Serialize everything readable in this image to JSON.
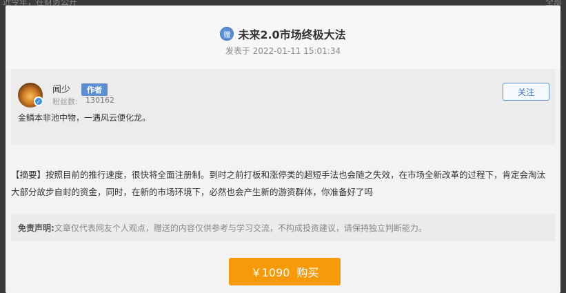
{
  "backdrop": {
    "left_text": "近今年，在财务公开",
    "right_text": "全部"
  },
  "post": {
    "title_icon_text": "赠",
    "title": "未来2.0市场终极大法",
    "time": "发表于 2022-01-11 15:01:34"
  },
  "author": {
    "name": "闻少",
    "tag": "作者",
    "fans_label": "粉丝数:",
    "fans_count": "130162",
    "follow_label": "关注",
    "signature": "金鳞本非池中物，一遇风云便化龙。",
    "verified_icon": "✓"
  },
  "summary": {
    "label": "【摘要】",
    "text": "按照目前的推行速度，很快将全面注册制。到时之前打板和涨停类的超短手法也会随之失效，在市场全新改革的过程下，肯定会淘汰大部分故步自封的资金，同时，在新的市场环境下，必然也会产生新的游资群体，你准备好了吗"
  },
  "disclaimer": {
    "label": "免责声明:",
    "text": "文章仅代表网友个人观点，赠送的内容仅供参考与学习交流，不构成投资建议，请保持独立判断能力。"
  },
  "purchase": {
    "price": "￥1090",
    "label": "购买"
  },
  "colors": {
    "accent": "#5b8fd2",
    "buy": "#f79a0a"
  }
}
